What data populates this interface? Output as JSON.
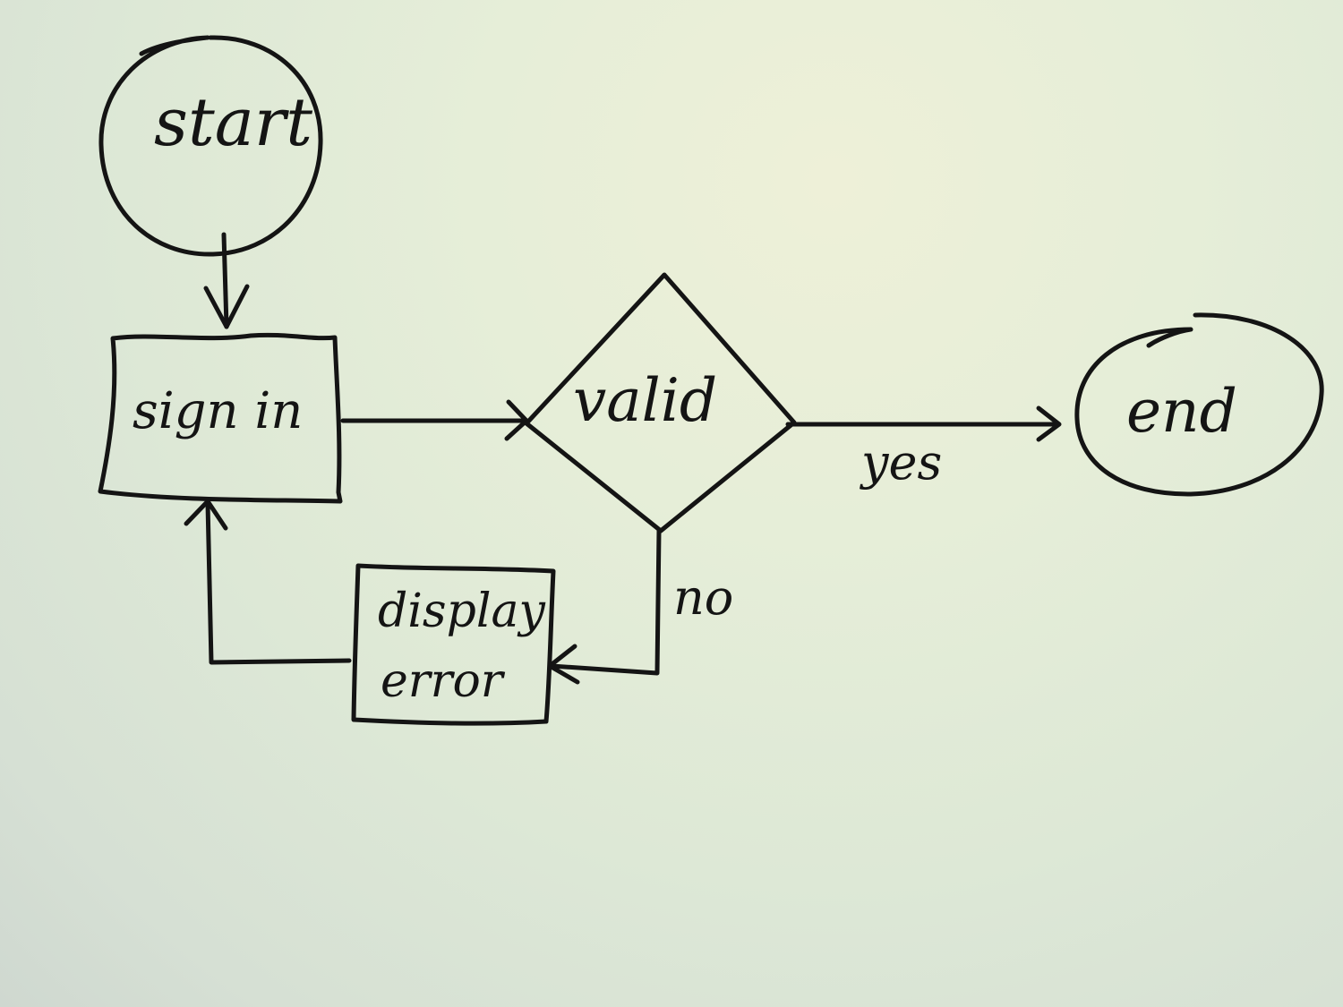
{
  "diagram": {
    "nodes": [
      {
        "id": "start",
        "shape": "circle",
        "label": "start"
      },
      {
        "id": "sign_in",
        "shape": "rectangle",
        "label": "sign in"
      },
      {
        "id": "valid",
        "shape": "diamond",
        "label": "valid"
      },
      {
        "id": "end",
        "shape": "ellipse",
        "label": "end"
      },
      {
        "id": "display_error",
        "shape": "rectangle",
        "label_line1": "display",
        "label_line2": "error"
      }
    ],
    "edges": [
      {
        "from": "start",
        "to": "sign_in",
        "label": ""
      },
      {
        "from": "sign_in",
        "to": "valid",
        "label": ""
      },
      {
        "from": "valid",
        "to": "end",
        "label": "yes"
      },
      {
        "from": "valid",
        "to": "display_error",
        "label": "no"
      },
      {
        "from": "display_error",
        "to": "sign_in",
        "label": ""
      }
    ],
    "yes_label": "yes",
    "no_label": "no",
    "ink_color": "#141414",
    "paper_color": "#e4ecd8"
  }
}
